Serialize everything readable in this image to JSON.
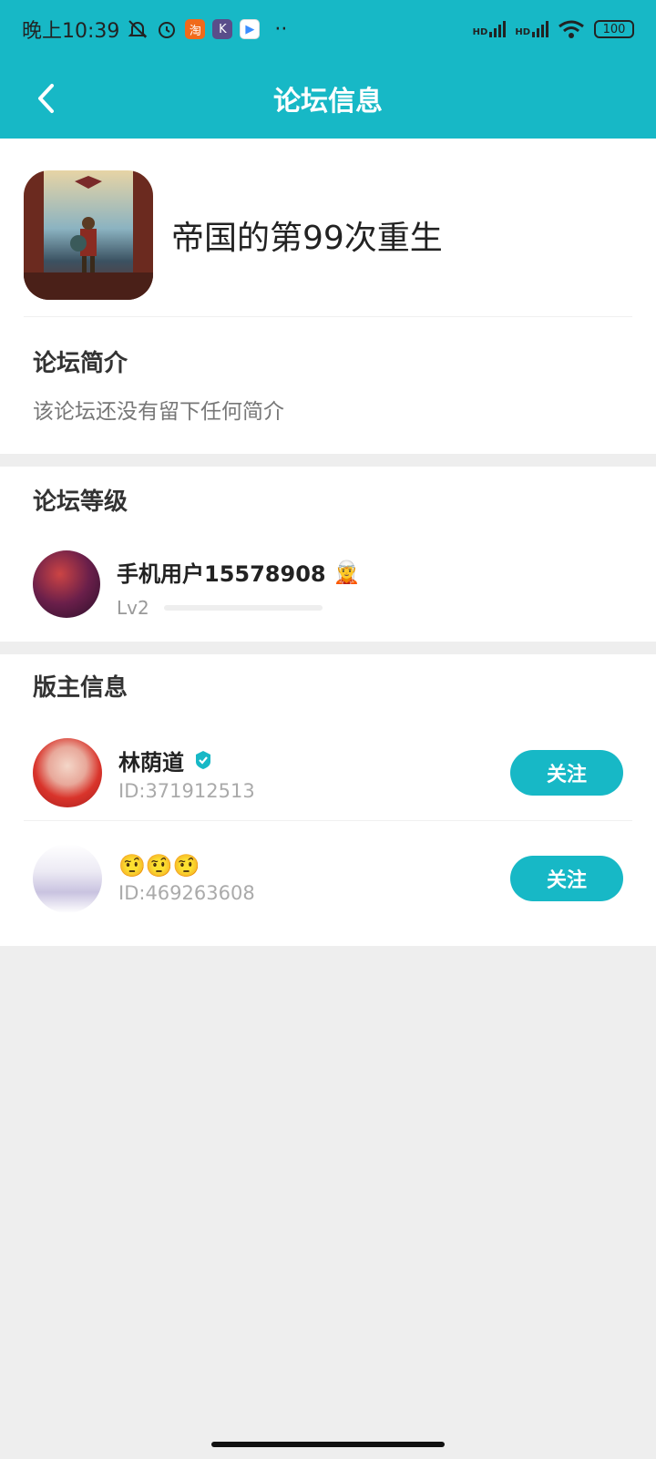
{
  "status_bar": {
    "time": "晚上10:39",
    "app_badges": [
      "淘",
      "K",
      "▶"
    ],
    "more": "··",
    "signal1": "HD",
    "signal2": "HD",
    "battery": "100"
  },
  "header": {
    "title": "论坛信息",
    "back_icon": "chevron-left-icon"
  },
  "forum": {
    "name": "帝国的第99次重生"
  },
  "intro": {
    "title": "论坛简介",
    "text": "该论坛还没有留下任何简介"
  },
  "level": {
    "title": "论坛等级",
    "user_name": "手机用户15578908",
    "user_emoji": "🧝",
    "level_label": "Lv2",
    "progress": 0
  },
  "moderators": {
    "title": "版主信息",
    "items": [
      {
        "name": "林荫道",
        "id": "ID:371912513",
        "follow": "关注",
        "verified": true
      },
      {
        "name": "🤨🤨🤨",
        "id": "ID:469263608",
        "follow": "关注",
        "verified": false
      }
    ]
  },
  "colors": {
    "accent": "#17b8c6",
    "background": "#eeeeee"
  }
}
